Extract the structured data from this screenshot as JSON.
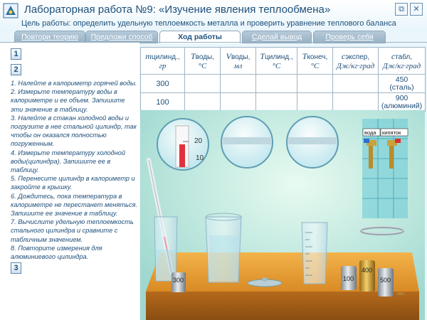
{
  "header": {
    "title": "Лабораторная работа №9: «Изучение явления теплообмена»",
    "subtitle": "Цель работы: определить удельную теплоемкость металла и проверить уравнение теплового баланса"
  },
  "tabs": [
    {
      "label": "Повтори теорию"
    },
    {
      "label": "Предложи способ"
    },
    {
      "label": "Ход работы"
    },
    {
      "label": "Сделай вывод"
    },
    {
      "label": "Проверь себя"
    }
  ],
  "side_buttons": [
    "1",
    "2",
    "3"
  ],
  "steps": [
    "1. Налейте в калориметр горячей воды.",
    "2. Измерьте температуру воды в калориметре и ее объем. Запишите эти значение  в таблицу.",
    "3. Налейте в стакан холодной воды и погрузите в нее стальной цилиндр, так чтобы он оказался полностью погруженным.",
    "4. Измерьте температуру холодной воды(цилиндра). Запишите ее в таблицу.",
    "5. Перенесите цилиндр в калориметр и закройте в крышку.",
    "6. Дождитесь, пока температура в калориметре не перестанет меняться. Запишите ее значение в таблицу.",
    "7. Вычислите удельную теплоемкость стального цилиндра и сравните с табличным значением.",
    "8. Повторите измерения для алюминиевого цилиндра."
  ],
  "table": {
    "headers": [
      {
        "sym": "m",
        "sub": "цилинд.,",
        "unit": "гр"
      },
      {
        "sym": "T",
        "sub": "воды,",
        "unit": "°C"
      },
      {
        "sym": "V",
        "sub": "воды,",
        "unit": "мл"
      },
      {
        "sym": "T",
        "sub": "цилинд.,",
        "unit": "°C"
      },
      {
        "sym": "T",
        "sub": "конеч,",
        "unit": "°C"
      },
      {
        "sym": "c",
        "sub": "экспер,",
        "unit": "Дж/кг·град"
      },
      {
        "sym": "c",
        "sub": "табл,",
        "unit": "Дж/кг·град"
      }
    ],
    "rows": [
      {
        "mass": "300",
        "ctab": "450",
        "material": "(сталь)"
      },
      {
        "mass": "100",
        "ctab": "900",
        "material": "(алюминий)"
      }
    ]
  },
  "scene": {
    "tap_labels": {
      "water": "вода",
      "boiling": "кипяток"
    },
    "thermometer_mark_top": "20",
    "thermometer_mark_bottom": "10",
    "weights": [
      "300",
      "100",
      "400",
      "500"
    ]
  }
}
